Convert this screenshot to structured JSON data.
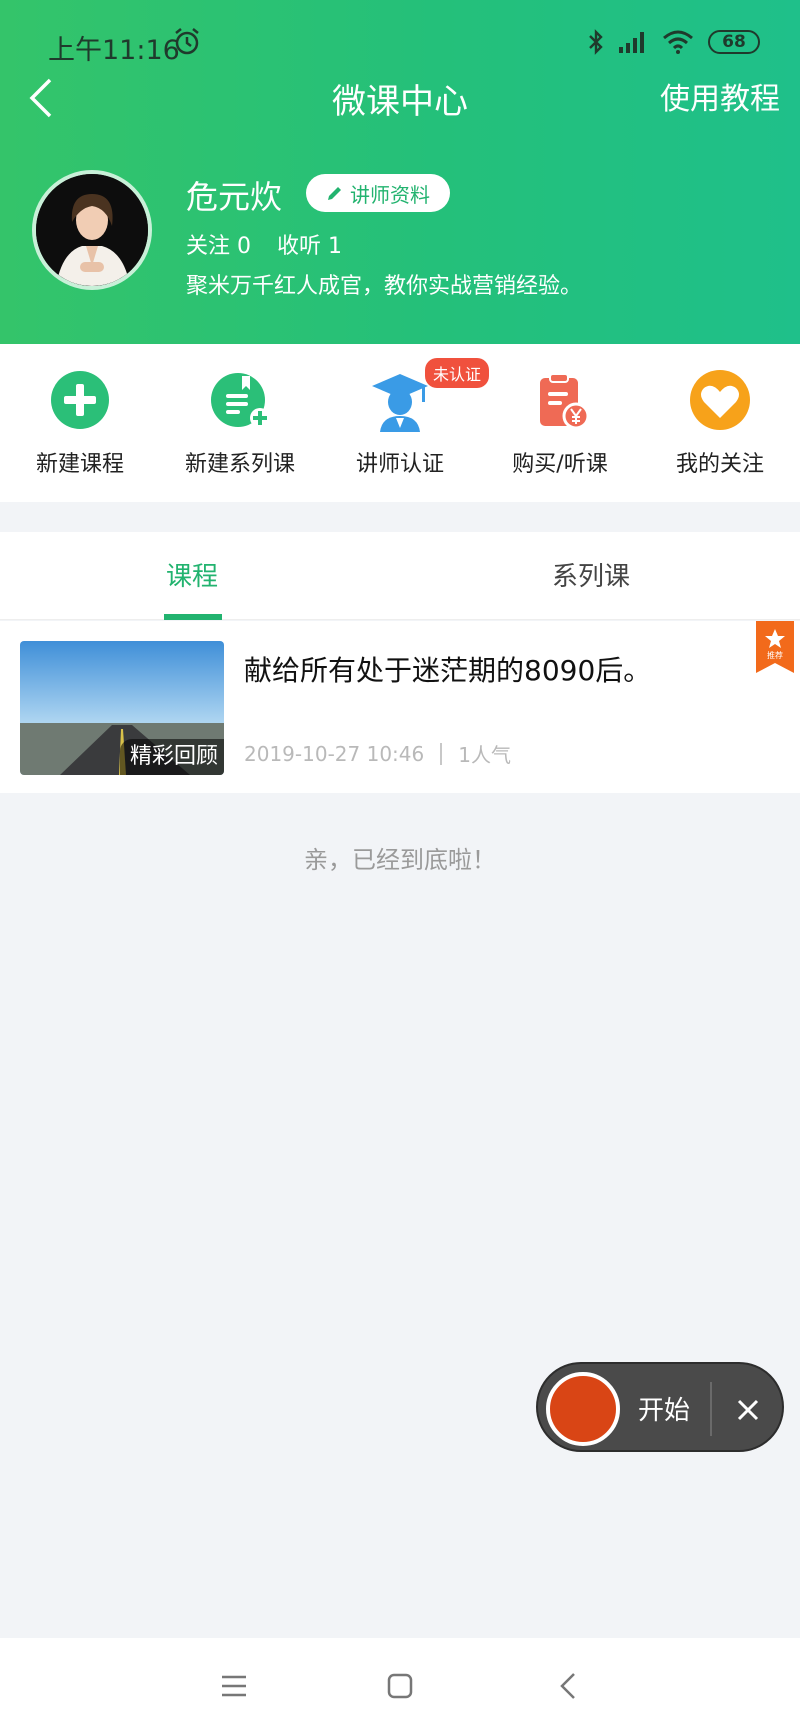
{
  "status_bar": {
    "time": "上午11:16",
    "battery": "68"
  },
  "nav": {
    "title": "微课中心",
    "tutorial": "使用教程"
  },
  "profile": {
    "name": "危元炊",
    "lecturer_button": "讲师资料",
    "follows": "关注 0",
    "listens": "收听 1",
    "bio": "聚米万千红人成官，教你实战营销经验。"
  },
  "actions": [
    {
      "label": "新建课程",
      "icon": "plus-circle-icon",
      "color": "#2bbf78"
    },
    {
      "label": "新建系列课",
      "icon": "new-series-icon",
      "color": "#2bbf78"
    },
    {
      "label": "讲师认证",
      "icon": "graduate-icon",
      "color": "#3a9be6"
    },
    {
      "label": "购买/听课",
      "icon": "clipboard-yen-icon",
      "color": "#ef6a55"
    },
    {
      "label": "我的关注",
      "icon": "heart-icon",
      "color": "#f7a21a"
    }
  ],
  "badge": "未认证",
  "tabs": {
    "course": "课程",
    "series": "系列课"
  },
  "course_item": {
    "title": "献给所有处于迷茫期的8090后。",
    "thumb_label": "精彩回顾",
    "date": "2019-10-27 10:46",
    "popularity": "1人气",
    "ribbon_label": "推荐"
  },
  "end_note": "亲，已经到底啦！",
  "recorder": {
    "start": "开始"
  },
  "colors": {
    "accent": "#22b36f",
    "badge": "#f0513d",
    "record": "#d94515"
  }
}
